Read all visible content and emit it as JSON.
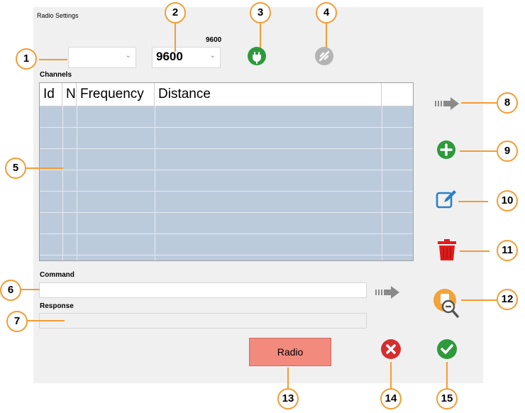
{
  "window": {
    "title": "Radio Settings"
  },
  "port": {
    "value": ""
  },
  "baud": {
    "caption": "9600",
    "value": "9600"
  },
  "channels": {
    "label": "Channels",
    "columns": [
      "Id",
      "N",
      "Frequency",
      "Distance",
      ""
    ]
  },
  "command": {
    "label": "Command",
    "value": ""
  },
  "response": {
    "label": "Response",
    "value": ""
  },
  "buttons": {
    "radio_label": "Radio"
  },
  "callouts": [
    "1",
    "2",
    "3",
    "4",
    "5",
    "6",
    "7",
    "8",
    "9",
    "10",
    "11",
    "12",
    "13",
    "14",
    "15"
  ],
  "icons": {
    "connect": "plug-icon",
    "disconnect": "unplug-icon",
    "send_row": "arrow-right-icon",
    "add": "plus-circle-icon",
    "edit": "edit-icon",
    "delete": "trash-icon",
    "send_command": "arrow-right-icon",
    "search": "zoom-out-icon",
    "cancel": "cancel-icon",
    "ok": "check-icon"
  },
  "colors": {
    "green": "#2e9a3c",
    "red": "#d62d2d",
    "orange": "#f39c34",
    "grid": "#bccbdc",
    "radio": "#f28a7e"
  }
}
